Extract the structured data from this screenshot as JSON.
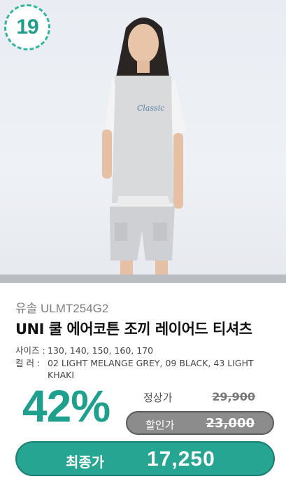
{
  "badge": {
    "rank": "19"
  },
  "product": {
    "brand_code": "유솔 ULMT254G2",
    "title": "UNI 쿨 에어코튼 조끼 레이어드 티셔츠",
    "size_label": "사이즈 :",
    "sizes": "130, 140, 150, 160, 170",
    "color_label": "컬    러 :",
    "colors": "02 LIGHT MELANGE GREY, 09 BLACK, 43 LIGHT KHAKI"
  },
  "pricing": {
    "discount": "42%",
    "regular_label": "정상가",
    "regular_price": "29,900",
    "sale_label": "할인가",
    "sale_price": "23,000",
    "final_label": "최종가",
    "final_price": "17,250"
  },
  "colors": {
    "accent": "#26a593",
    "badge_border": "#32b5a3",
    "sale_pill": "#8c8c8c"
  }
}
